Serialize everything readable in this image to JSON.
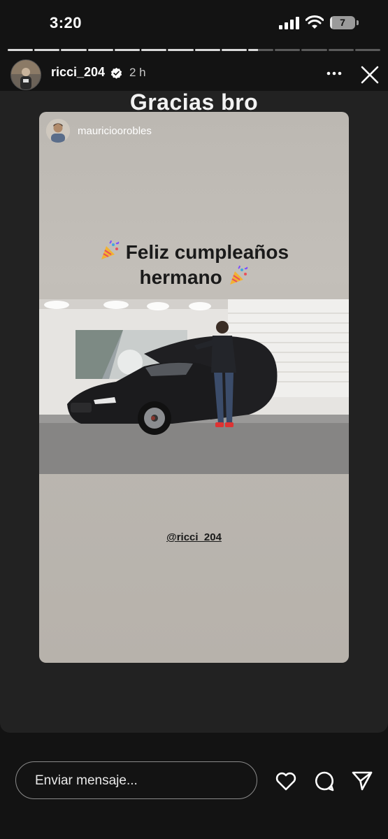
{
  "status_bar": {
    "time": "3:20",
    "battery_level": "7"
  },
  "story": {
    "segment_count": 14,
    "current_segment": 10,
    "current_segment_progress": 0.4,
    "username": "ricci_204",
    "time_ago": "2 h",
    "headline": "Gracias bro",
    "reshared": {
      "username": "mauricioorobles",
      "greeting_line1": "Feliz cumpleaños",
      "greeting_line2": "hermano",
      "mention": "@ricci_204"
    }
  },
  "bottom_bar": {
    "message_placeholder": "Enviar mensaje...",
    "icons": [
      "heart-icon",
      "comment-icon",
      "send-icon"
    ]
  },
  "colors": {
    "background": "#131313",
    "story_bg": "#222222",
    "card_bg": "#bcb8b2",
    "verified": "#ffffff"
  }
}
